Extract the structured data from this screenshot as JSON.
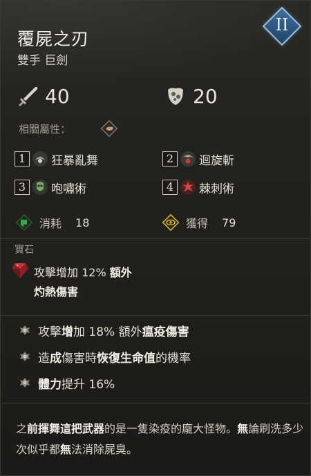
{
  "item": {
    "name": "覆屍之刃",
    "type": "雙手 巨劍",
    "tier": "II"
  },
  "stats": {
    "attack": "40",
    "armor": "20"
  },
  "related": {
    "label": "相關屬性："
  },
  "skills": [
    {
      "num": "1",
      "name": "狂暴亂舞",
      "icon": "frenzy-icon"
    },
    {
      "num": "2",
      "name": "迴旋斬",
      "icon": "whirlwind-icon"
    },
    {
      "num": "3",
      "name": "咆嘯術",
      "icon": "howl-icon"
    },
    {
      "num": "4",
      "name": "棘刺術",
      "icon": "thorns-icon"
    }
  ],
  "resources": {
    "cost_label": "消耗",
    "cost_value": "18",
    "gain_label": "獲得",
    "gain_value": "79"
  },
  "gem": {
    "section_label": "寶石",
    "line1_a": "攻擊增加 12% ",
    "line1_b": "額外",
    "line2": "灼熱傷害"
  },
  "affixes": [
    {
      "pre": "攻擊",
      "mid": "增",
      "post1": "加 18% 額外",
      "bold": "瘟疫傷害",
      "post2": ""
    },
    {
      "pre": "造",
      "mid": "成",
      "post1": "傷害時",
      "bold": "恢復生命值",
      "post2": "的機率"
    },
    {
      "pre": "",
      "mid": "體力",
      "post1": "提升 16%",
      "bold": "",
      "post2": ""
    }
  ],
  "lore": {
    "p1": "之",
    "p2": "前揮舞這把",
    "p3": "武器",
    "p4": "的是一隻染疫的龐大怪物。",
    "p5": "無",
    "p6": "論刷洗多少次似乎都",
    "p7": "無",
    "p8": "法消除屍臭。"
  },
  "colors": {
    "background": "#23221f",
    "tier_badge": "#2f5d86",
    "cost_icon": "#3aa84a",
    "gain_icon": "#d8b63a",
    "gem": "#b52a2a"
  }
}
